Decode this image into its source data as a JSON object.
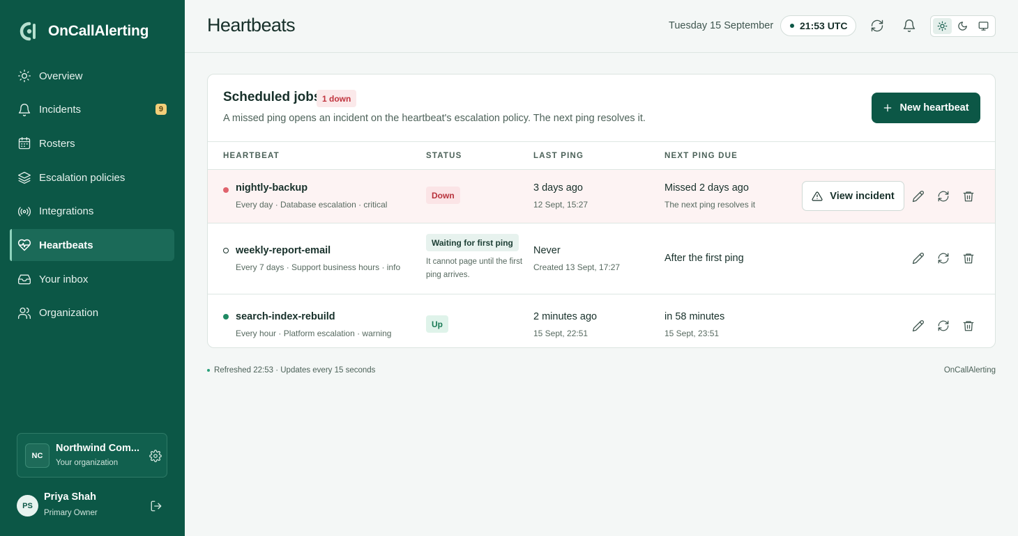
{
  "brand": {
    "name": "OnCallAlerting"
  },
  "sidebar": {
    "items": [
      {
        "label": "Overview",
        "icon": "sun-icon"
      },
      {
        "label": "Incidents",
        "icon": "bell-icon",
        "badge": "9"
      },
      {
        "label": "Rosters",
        "icon": "calendar-icon"
      },
      {
        "label": "Escalation policies",
        "icon": "layers-icon"
      },
      {
        "label": "Integrations",
        "icon": "broadcast-icon"
      },
      {
        "label": "Heartbeats",
        "icon": "heart-pulse-icon",
        "active": true
      },
      {
        "label": "Your inbox",
        "icon": "inbox-icon"
      },
      {
        "label": "Organization",
        "icon": "users-icon"
      }
    ],
    "org": {
      "initials": "NC",
      "name": "Northwind Com...",
      "subtitle": "Your organization"
    },
    "user": {
      "initials": "PS",
      "name": "Priya Shah",
      "role": "Primary Owner"
    }
  },
  "header": {
    "title": "Heartbeats",
    "date": "Tuesday 15 September",
    "time": "21:53 UTC"
  },
  "card": {
    "title": "Scheduled jobs",
    "badge": "1 down",
    "description": "A missed ping opens an incident on the heartbeat's escalation policy. The next ping resolves it.",
    "new_button": "New heartbeat",
    "columns": [
      "HEARTBEAT",
      "STATUS",
      "LAST PING",
      "NEXT PING DUE"
    ],
    "rows": [
      {
        "name": "nightly-backup",
        "meta": "Every day · Database escalation · critical",
        "status": "Down",
        "last_main": "3 days ago",
        "last_sub": "12 Sept, 15:27",
        "next_main": "Missed 2 days ago",
        "next_sub": "The next ping resolves it",
        "action": "View incident"
      },
      {
        "name": "weekly-report-email",
        "meta": "Every 7 days · Support business hours · info",
        "status": "Waiting for first ping",
        "status_note": "It cannot page until the first ping arrives.",
        "last_main": "Never",
        "last_sub": "Created 13 Sept, 17:27",
        "next_main": "After the first ping"
      },
      {
        "name": "search-index-rebuild",
        "meta": "Every hour · Platform escalation · warning",
        "status": "Up",
        "last_main": "2 minutes ago",
        "last_sub": "15 Sept, 22:51",
        "next_main": "in 58 minutes",
        "next_sub": "15 Sept, 23:51"
      }
    ]
  },
  "footer": {
    "refresh": "Refreshed 22:53 · Updates every 15 seconds",
    "brand": "OnCallAlerting"
  },
  "colors": {
    "sidebar": "#0c5746",
    "accent": "#0c5746",
    "down": "#e0636d",
    "up": "#1f8a63"
  }
}
